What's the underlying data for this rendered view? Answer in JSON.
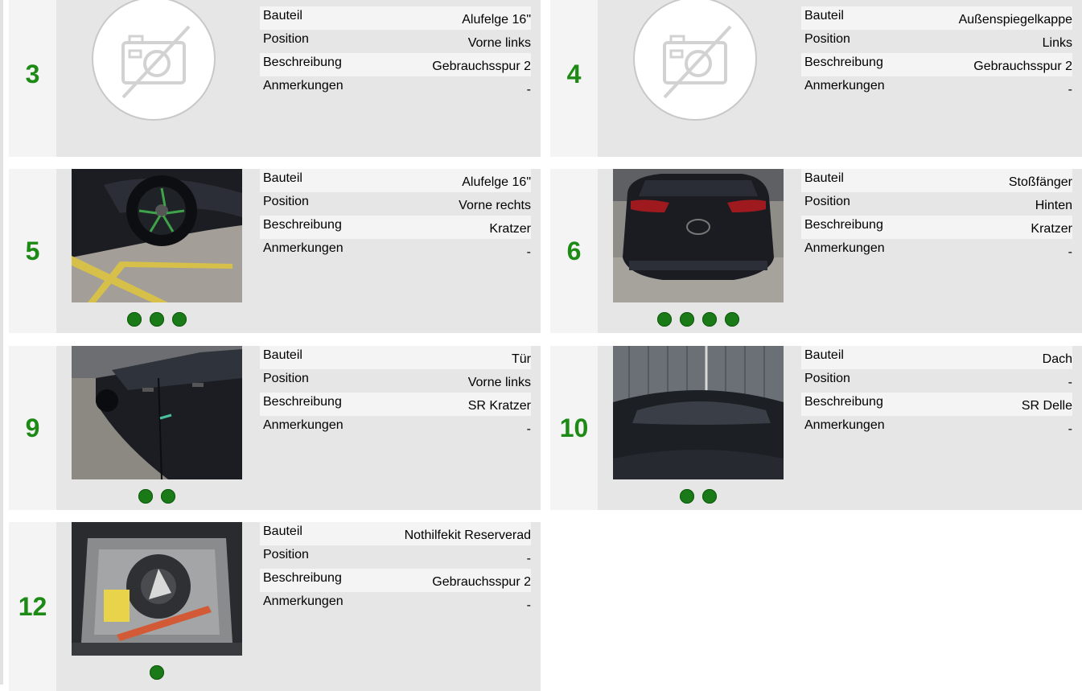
{
  "colors": {
    "number": "#1d8a16",
    "dot": "#1a7a17",
    "card_bg": "#e6e6e6",
    "number_col_bg": "#f4f4f4"
  },
  "labels": {
    "part": "Bauteil",
    "position": "Position",
    "description": "Beschreibung",
    "notes": "Anmerkungen"
  },
  "cards": [
    {
      "number": "3",
      "photo": "no-image-icon",
      "dots": 0,
      "part": "Alufelge 16\"",
      "position": "Vorne links",
      "description": "Gebrauchsspur 2",
      "notes": "-"
    },
    {
      "number": "4",
      "photo": "no-image-icon",
      "dots": 0,
      "part": "Außenspiegelkappe",
      "position": "Links",
      "description": "Gebrauchsspur 2",
      "notes": "-"
    },
    {
      "number": "5",
      "photo": "front-wheel-photo",
      "dots": 3,
      "part": "Alufelge 16\"",
      "position": "Vorne rechts",
      "description": "Kratzer",
      "notes": "-"
    },
    {
      "number": "6",
      "photo": "rear-bumper-photo",
      "dots": 4,
      "part": "Stoßfänger",
      "position": "Hinten",
      "description": "Kratzer",
      "notes": "-"
    },
    {
      "number": "9",
      "photo": "front-door-photo",
      "dots": 2,
      "part": "Tür",
      "position": "Vorne links",
      "description": "SR Kratzer",
      "notes": "-"
    },
    {
      "number": "10",
      "photo": "roof-photo",
      "dots": 2,
      "part": "Dach",
      "position": "-",
      "description": "SR Delle",
      "notes": "-"
    },
    {
      "number": "12",
      "photo": "spare-wheel-kit-photo",
      "dots": 1,
      "part": "Nothilfekit Reserverad",
      "position": "-",
      "description": "Gebrauchsspur 2",
      "notes": "-"
    }
  ]
}
